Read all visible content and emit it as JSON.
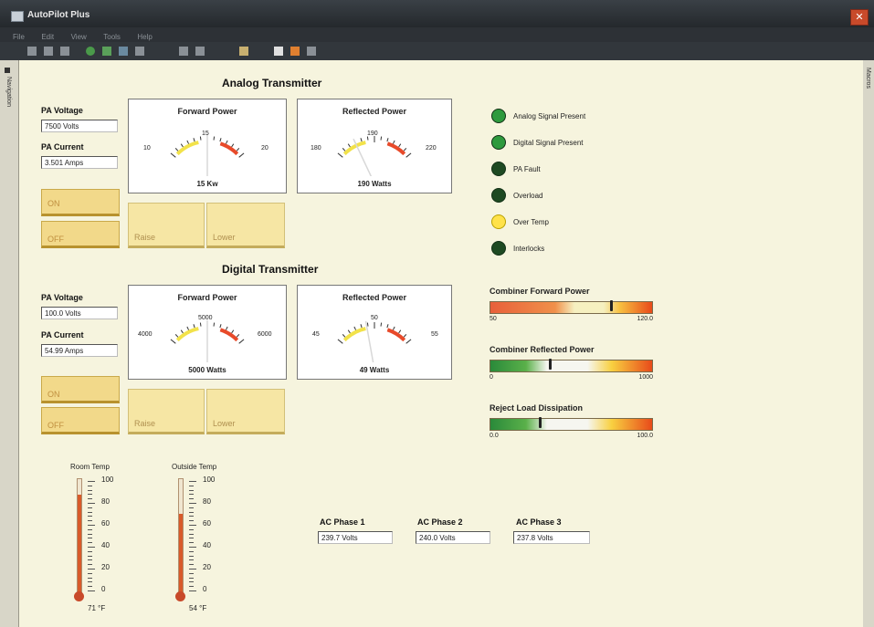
{
  "window": {
    "title": "AutoPilot Plus"
  },
  "menu": [
    "File",
    "Edit",
    "View",
    "Tools",
    "Help"
  ],
  "side": {
    "left": "Navigation",
    "right": "Macros"
  },
  "analog": {
    "title": "Analog Transmitter",
    "pa_voltage_label": "PA Voltage",
    "pa_voltage": "7500 Volts",
    "pa_current_label": "PA Current",
    "pa_current": "3.501 Amps",
    "on_label": "ON",
    "off_label": "OFF",
    "raise_label": "Raise",
    "lower_label": "Lower",
    "forward": {
      "title": "Forward Power",
      "min": "10",
      "mid": "15",
      "max": "20",
      "readout": "15 Kw",
      "value": 15,
      "low": 10,
      "high": 20
    },
    "reflected": {
      "title": "Reflected Power",
      "min": "180",
      "mid": "190",
      "max": "220",
      "readout": "190 Watts",
      "value": 190,
      "low": 180,
      "high": 220
    }
  },
  "digital": {
    "title": "Digital Transmitter",
    "pa_voltage_label": "PA Voltage",
    "pa_voltage": "100.0 Volts",
    "pa_current_label": "PA Current",
    "pa_current": "54.99 Amps",
    "on_label": "ON",
    "off_label": "OFF",
    "raise_label": "Raise",
    "lower_label": "Lower",
    "forward": {
      "title": "Forward Power",
      "min": "4000",
      "mid": "5000",
      "max": "6000",
      "readout": "5000 Watts",
      "value": 5000,
      "low": 4000,
      "high": 6000
    },
    "reflected": {
      "title": "Reflected Power",
      "min": "45",
      "mid": "50",
      "max": "55",
      "readout": "49 Watts",
      "value": 49,
      "low": 45,
      "high": 55
    }
  },
  "status": [
    {
      "label": "Analog Signal Present",
      "color": "#2e9a3e"
    },
    {
      "label": "Digital Signal Present",
      "color": "#2e9a3e"
    },
    {
      "label": "PA Fault",
      "color": "#1e4a22"
    },
    {
      "label": "Overload",
      "color": "#1e4a22"
    },
    {
      "label": "Over Temp",
      "color": "#ffe24a"
    },
    {
      "label": "Interlocks",
      "color": "#1e4a22"
    }
  ],
  "bars": [
    {
      "title": "Combiner Forward Power",
      "min": "50",
      "max": "120.0",
      "value": 102,
      "low": 50,
      "high": 120,
      "scheme": "hot"
    },
    {
      "title": "Combiner Reflected Power",
      "min": "0",
      "max": "1000",
      "value": 360,
      "low": 0,
      "high": 1000,
      "scheme": "cold"
    },
    {
      "title": "Reject Load Dissipation",
      "min": "0.0",
      "max": "100.0",
      "value": 30,
      "low": 0,
      "high": 100,
      "scheme": "cold"
    }
  ],
  "temps": [
    {
      "title": "Room Temp",
      "readout": "71 °F",
      "value": 71,
      "scale": [
        "100",
        "80",
        "60",
        "40",
        "20",
        "0"
      ]
    },
    {
      "title": "Outside Temp",
      "readout": "54 °F",
      "value": 54,
      "scale": [
        "100",
        "80",
        "60",
        "40",
        "20",
        "0"
      ]
    }
  ],
  "ac": [
    {
      "label": "AC Phase 1",
      "value": "239.7 Volts"
    },
    {
      "label": "AC Phase 2",
      "value": "240.0 Volts"
    },
    {
      "label": "AC Phase 3",
      "value": "237.8 Volts"
    }
  ]
}
